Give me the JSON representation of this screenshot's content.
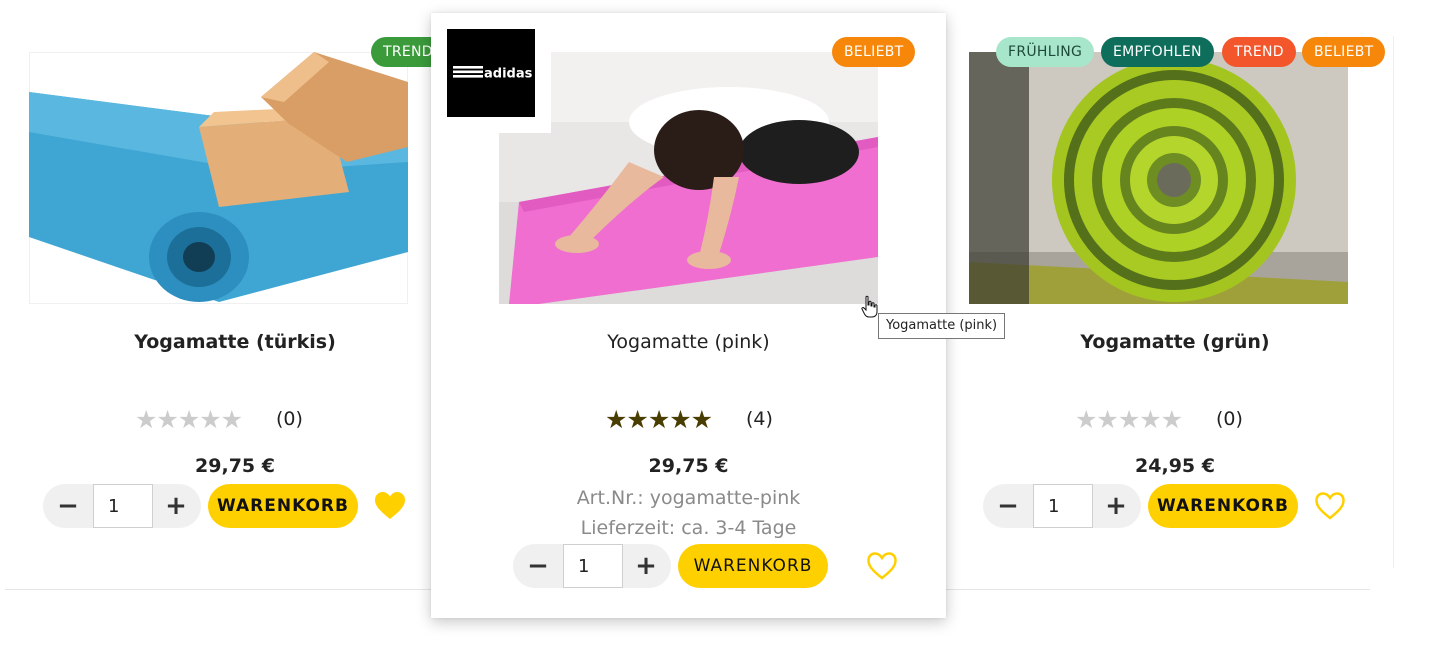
{
  "products": [
    {
      "title": "Yogamatte (türkis)",
      "badges": [
        {
          "label": "TREND",
          "color": "#3b9b3b"
        }
      ],
      "stars": "★★★★★",
      "rating_count": "(0)",
      "price": "29,75 €",
      "qty": "1",
      "qty_minus": "−",
      "qty_plus": "+",
      "cart_label": "WARENKORB",
      "favorite": true
    },
    {
      "title": "Yogamatte (pink)",
      "brand": "adidas",
      "badges": [
        {
          "label": "BELIEBT",
          "color": "#f7870a"
        }
      ],
      "stars": "★★★★★",
      "rating_count": "(4)",
      "price": "29,75 €",
      "article_number": "Art.Nr.: yogamatte-pink",
      "delivery_time": "Lieferzeit: ca. 3-4 Tage",
      "qty": "1",
      "qty_minus": "−",
      "qty_plus": "+",
      "cart_label": "WARENKORB",
      "favorite": false,
      "tooltip": "Yogamatte (pink)"
    },
    {
      "title": "Yogamatte (grün)",
      "badges": [
        {
          "label": "FRÜHLING",
          "color": "#a8e6cc"
        },
        {
          "label": "EMPFOHLEN",
          "color": "#0f6e5b"
        },
        {
          "label": "TREND",
          "color": "#f2562a"
        },
        {
          "label": "BELIEBT",
          "color": "#f7870a"
        }
      ],
      "stars": "★★★★★",
      "rating_count": "(0)",
      "price": "24,95 €",
      "qty": "1",
      "qty_minus": "−",
      "qty_plus": "+",
      "cart_label": "WARENKORB",
      "favorite": false
    }
  ],
  "colors": {
    "accent_yellow": "#ffd000",
    "star_filled": "#4a3d00",
    "star_empty": "#cccccc",
    "heart": "#ffd000"
  }
}
